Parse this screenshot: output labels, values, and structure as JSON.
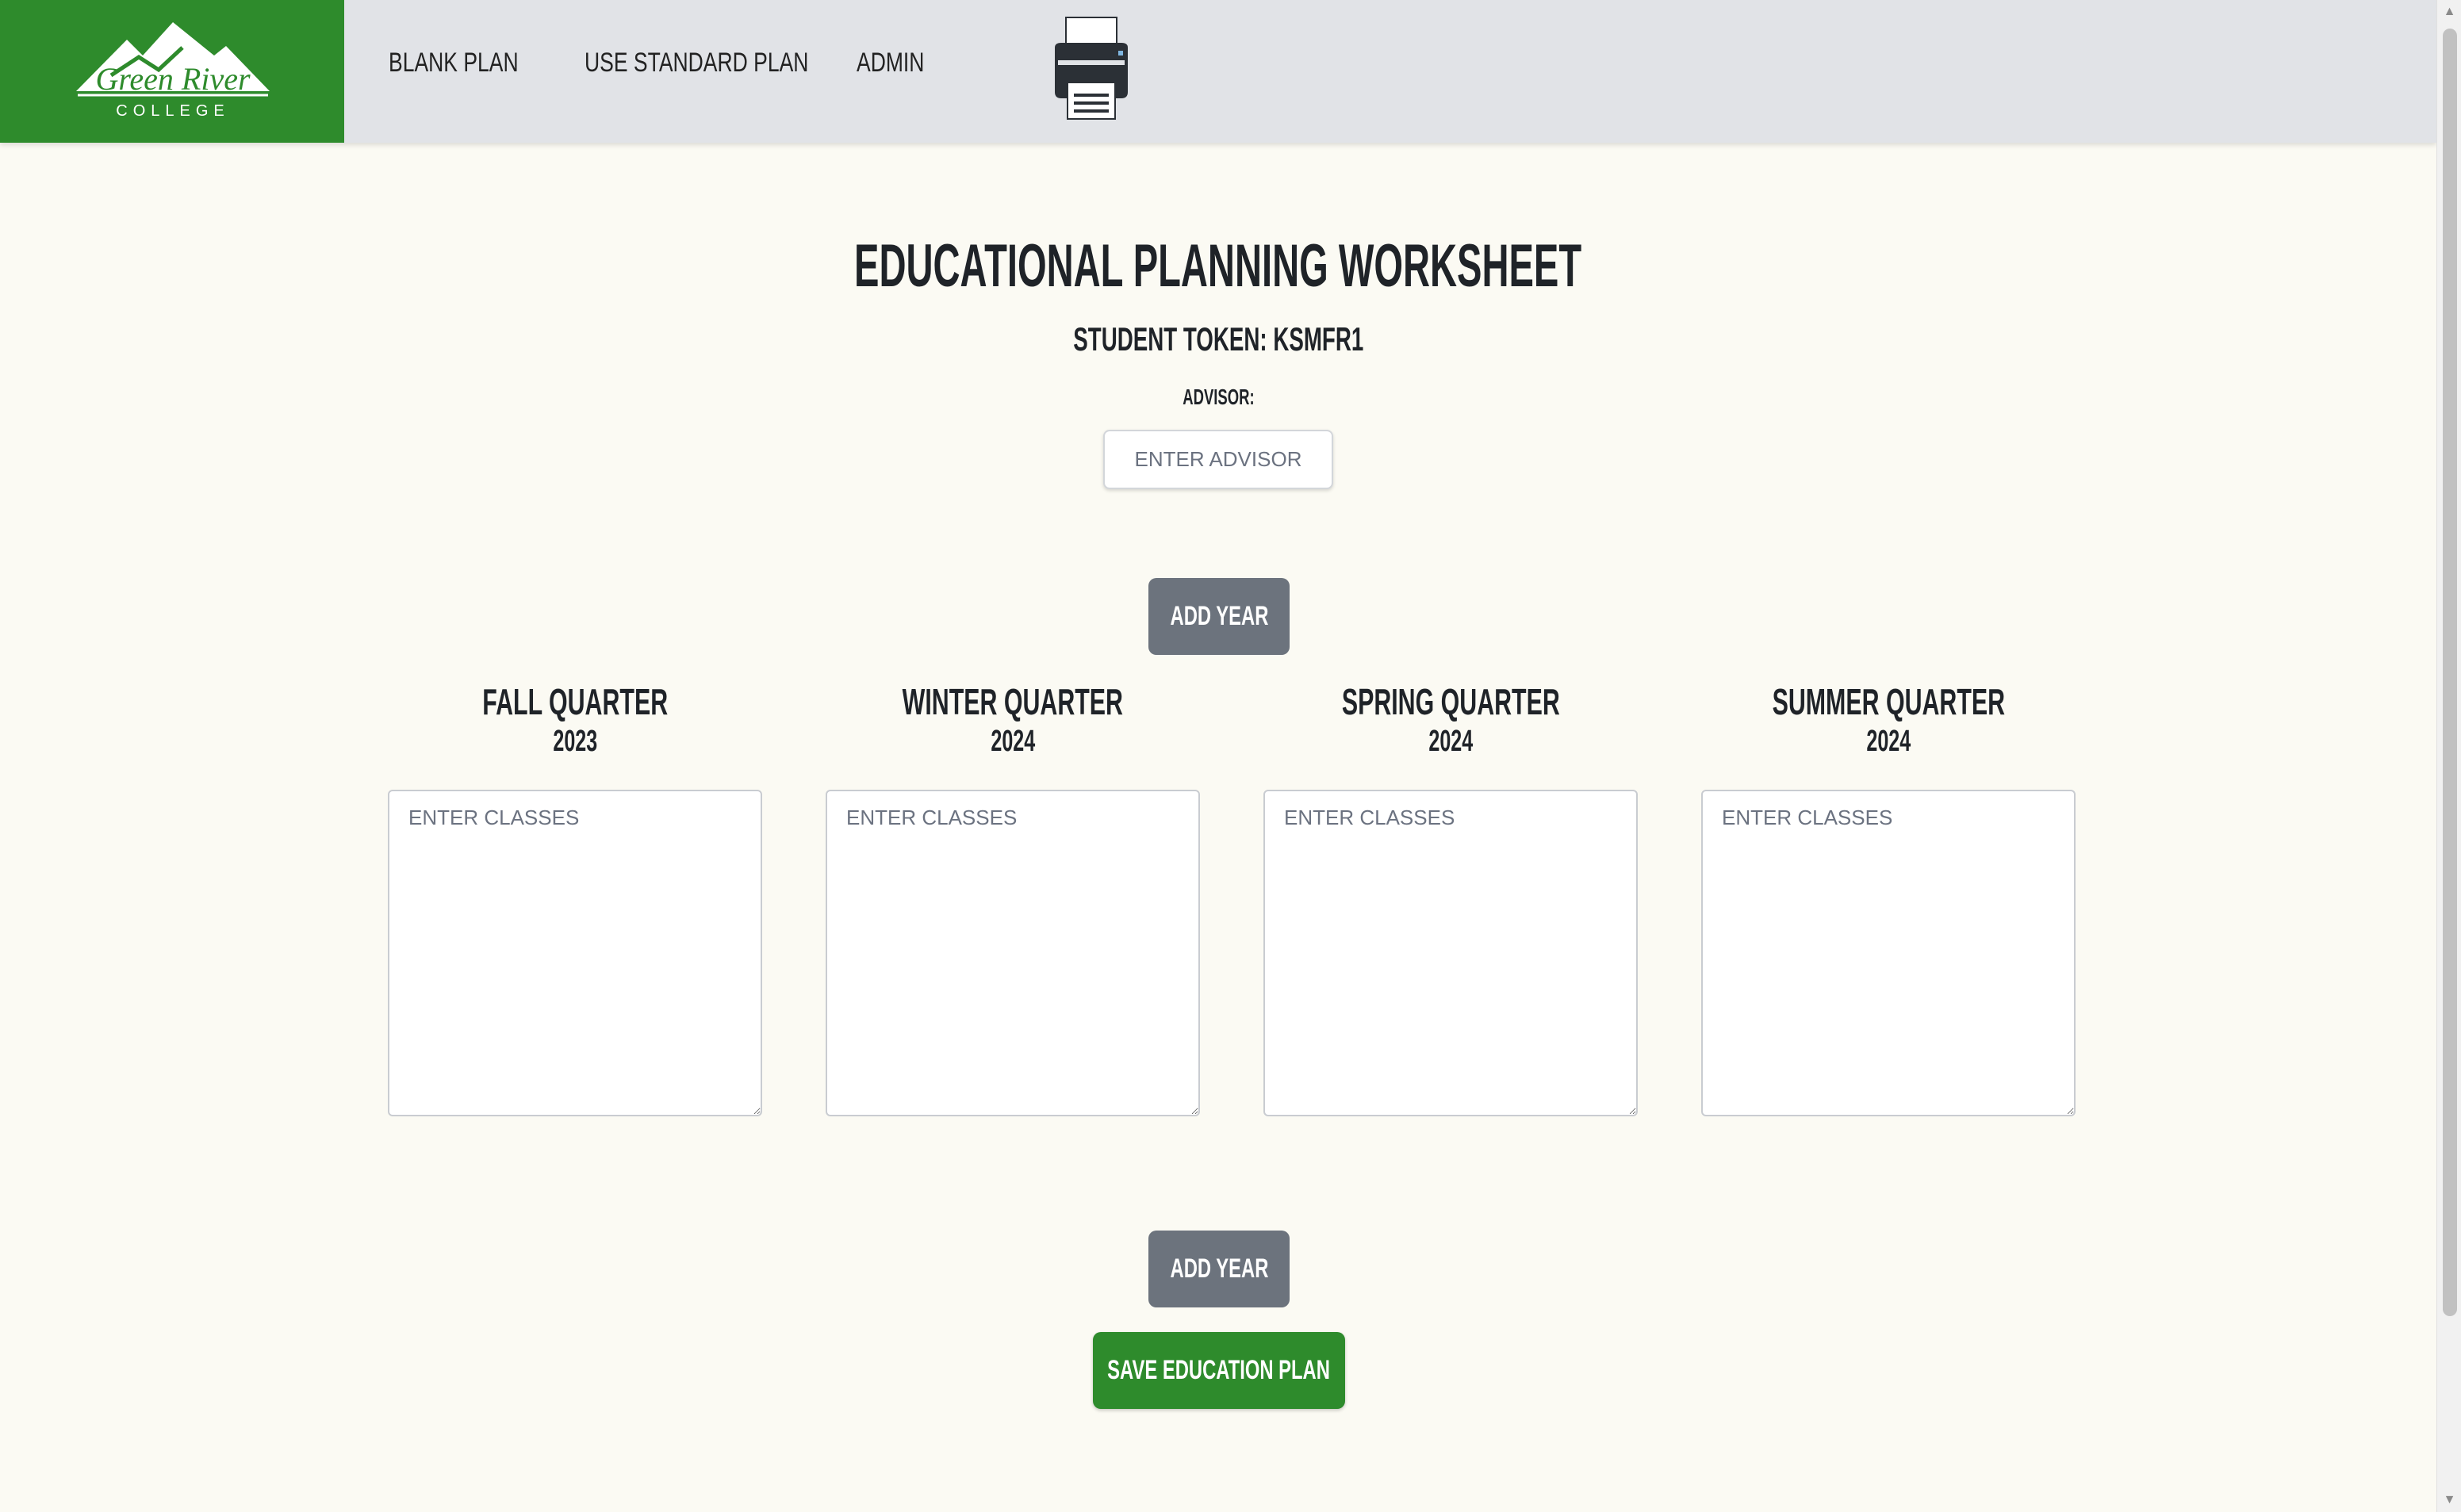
{
  "brand": {
    "name": "Green River",
    "subname": "COLLEGE",
    "color": "#2e8b2c"
  },
  "nav": {
    "items": [
      {
        "label": "Blank Plan"
      },
      {
        "label": "Use Standard Plan"
      },
      {
        "label": "Admin"
      }
    ],
    "print_icon": "printer-icon"
  },
  "page": {
    "title": "Educational Planning Worksheet",
    "student_token": "Student Token: KSMFR1",
    "advisor_label": "Advisor:",
    "advisor_placeholder": "Enter Advisor",
    "advisor_value": ""
  },
  "buttons": {
    "add_year_top": "Add Year",
    "add_year_bottom": "Add Year",
    "save": "Save Education Plan"
  },
  "quarters": [
    {
      "name": "Fall Quarter",
      "year": "2023",
      "placeholder": "Enter classes",
      "value": ""
    },
    {
      "name": "Winter Quarter",
      "year": "2024",
      "placeholder": "Enter classes",
      "value": ""
    },
    {
      "name": "Spring Quarter",
      "year": "2024",
      "placeholder": "Enter classes",
      "value": ""
    },
    {
      "name": "Summer Quarter",
      "year": "2024",
      "placeholder": "Enter classes",
      "value": ""
    }
  ],
  "colors": {
    "accent_green": "#2e8b2c",
    "button_gray": "#6c737d",
    "navbar_bg": "#e1e3e7",
    "page_bg": "#fbfaf3"
  }
}
